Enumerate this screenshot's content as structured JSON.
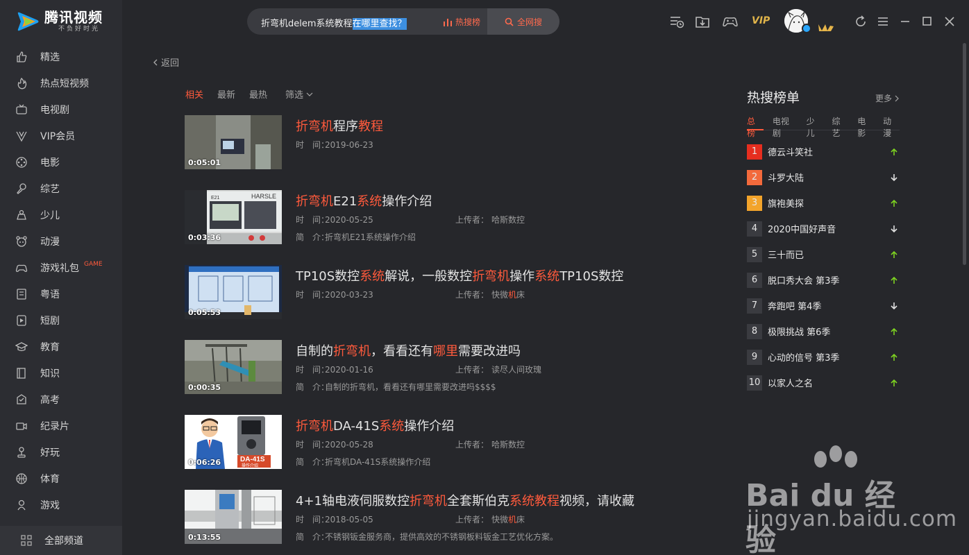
{
  "app": {
    "title": "腾讯视频",
    "slogan": "不负好时光"
  },
  "sidebar": {
    "items": [
      {
        "label": "精选",
        "icon": "thumbs-up-icon"
      },
      {
        "label": "热点短视频",
        "icon": "flame-icon"
      },
      {
        "label": "电视剧",
        "icon": "tv-icon"
      },
      {
        "label": "VIP会员",
        "icon": "vip-icon"
      },
      {
        "label": "电影",
        "icon": "film-reel-icon"
      },
      {
        "label": "综艺",
        "icon": "microphone-icon"
      },
      {
        "label": "少儿",
        "icon": "kids-icon"
      },
      {
        "label": "动漫",
        "icon": "anime-icon"
      },
      {
        "label": "游戏礼包",
        "icon": "gamepad-icon",
        "badge": "GAME"
      },
      {
        "label": "粤语",
        "icon": "book-icon"
      },
      {
        "label": "短剧",
        "icon": "short-drama-icon"
      },
      {
        "label": "教育",
        "icon": "graduation-cap-icon"
      },
      {
        "label": "知识",
        "icon": "knowledge-icon"
      },
      {
        "label": "高考",
        "icon": "exam-icon"
      },
      {
        "label": "纪录片",
        "icon": "camera-icon"
      },
      {
        "label": "好玩",
        "icon": "joystick-icon"
      },
      {
        "label": "体育",
        "icon": "basketball-icon"
      },
      {
        "label": "游戏",
        "icon": "game-icon"
      }
    ],
    "all_channels": "全部频道"
  },
  "search": {
    "query_plain": "折弯机delem系统教程",
    "query_selected": "在哪里查找？",
    "hot_label": "热搜榜",
    "web_search_label": "全网搜"
  },
  "header": {
    "vip_label": "VIP"
  },
  "main": {
    "back_label": "返回",
    "filters": {
      "related": "相关",
      "latest": "最新",
      "hottest": "最热",
      "filter": "筛选"
    },
    "time_key": "时　间：",
    "uploader_key": "上传者：",
    "intro_key": "简　介：",
    "results": [
      {
        "title_parts": [
          {
            "t": "折弯机",
            "hl": true
          },
          {
            "t": "程序",
            "hl": false
          },
          {
            "t": "教程",
            "hl": true
          }
        ],
        "duration": "0:05:01",
        "date": "2019-06-23",
        "uploader": "",
        "intro": ""
      },
      {
        "title_parts": [
          {
            "t": "折弯机",
            "hl": true
          },
          {
            "t": "E21",
            "hl": false
          },
          {
            "t": "系统",
            "hl": true
          },
          {
            "t": "操作介绍",
            "hl": false
          }
        ],
        "duration": "0:03:36",
        "date": "2020-05-25",
        "uploader": "哈斯数控",
        "intro": "折弯机E21系统操作介绍"
      },
      {
        "title_parts": [
          {
            "t": "TP10S数控",
            "hl": false
          },
          {
            "t": "系统",
            "hl": true
          },
          {
            "t": "解说，一般数控",
            "hl": false
          },
          {
            "t": "折弯机",
            "hl": true
          },
          {
            "t": "操作",
            "hl": false
          },
          {
            "t": "系统",
            "hl": true
          },
          {
            "t": "TP10S数控",
            "hl": false
          }
        ],
        "duration": "0:05:53",
        "date": "2020-03-23",
        "uploader_parts": [
          {
            "t": "快微",
            "hl": false
          },
          {
            "t": "机",
            "hl": true
          },
          {
            "t": "床",
            "hl": false
          }
        ],
        "intro": ""
      },
      {
        "title_parts": [
          {
            "t": "自制的",
            "hl": false
          },
          {
            "t": "折弯机",
            "hl": true
          },
          {
            "t": "，看看还有",
            "hl": false
          },
          {
            "t": "哪里",
            "hl": true
          },
          {
            "t": "需要改进吗",
            "hl": false
          }
        ],
        "duration": "0:00:35",
        "date": "2020-01-16",
        "uploader": "读尽人间玫瑰",
        "intro": "自制的折弯机，看看还有哪里需要改进吗$$$$"
      },
      {
        "title_parts": [
          {
            "t": "折弯机",
            "hl": true
          },
          {
            "t": "DA-41S",
            "hl": false
          },
          {
            "t": "系统",
            "hl": true
          },
          {
            "t": "操作介绍",
            "hl": false
          }
        ],
        "duration": "0:06:26",
        "date": "2020-05-28",
        "uploader": "哈斯数控",
        "intro": "折弯机DA-41S系统操作介绍"
      },
      {
        "title_parts": [
          {
            "t": "4+1轴电液伺服数控",
            "hl": false
          },
          {
            "t": "折弯机",
            "hl": true
          },
          {
            "t": "全套斯伯克",
            "hl": false
          },
          {
            "t": "系统教程",
            "hl": true
          },
          {
            "t": "视频，请收藏",
            "hl": false
          }
        ],
        "duration": "0:13:55",
        "date": "2018-05-05",
        "uploader_parts": [
          {
            "t": "快微",
            "hl": false
          },
          {
            "t": "机",
            "hl": true
          },
          {
            "t": "床",
            "hl": false
          }
        ],
        "intro": "不锈钢钣金服务商，提供高效的不锈钢板料钣金工艺优化方案。"
      }
    ],
    "thumb_texts": {
      "e21_brand": "HARSLE",
      "e21_model": "E21",
      "da41s": "DA-41S",
      "da41s_sub": "操作介绍"
    }
  },
  "hot": {
    "title": "热搜榜单",
    "more": "更多",
    "tabs": [
      "总榜",
      "电视剧",
      "少儿",
      "综艺",
      "电影",
      "动漫"
    ],
    "items": [
      {
        "rank": "1",
        "name": "德云斗笑社",
        "trend": "up",
        "color": "#e62e1f"
      },
      {
        "rank": "2",
        "name": "斗罗大陆",
        "trend": "down",
        "color": "#f36a3c"
      },
      {
        "rank": "3",
        "name": "旗袍美探",
        "trend": "up",
        "color": "#f3a42b"
      },
      {
        "rank": "4",
        "name": "2020中国好声音",
        "trend": "down",
        "color": ""
      },
      {
        "rank": "5",
        "name": "三十而已",
        "trend": "up",
        "color": ""
      },
      {
        "rank": "6",
        "name": "脱口秀大会 第3季",
        "trend": "up",
        "color": ""
      },
      {
        "rank": "7",
        "name": "奔跑吧 第4季",
        "trend": "down",
        "color": ""
      },
      {
        "rank": "8",
        "name": "极限挑战 第6季",
        "trend": "up",
        "color": ""
      },
      {
        "rank": "9",
        "name": "心动的信号 第3季",
        "trend": "up",
        "color": ""
      },
      {
        "rank": "10",
        "name": "以家人之名",
        "trend": "up",
        "color": ""
      }
    ]
  },
  "watermark": {
    "brand": "Bai du 经验",
    "url": "jingyan.baidu.com"
  },
  "colors": {
    "accent": "#ff5a3c",
    "up": "#7ed321",
    "bg": "#26272b",
    "sidebar": "#2c2d32"
  }
}
